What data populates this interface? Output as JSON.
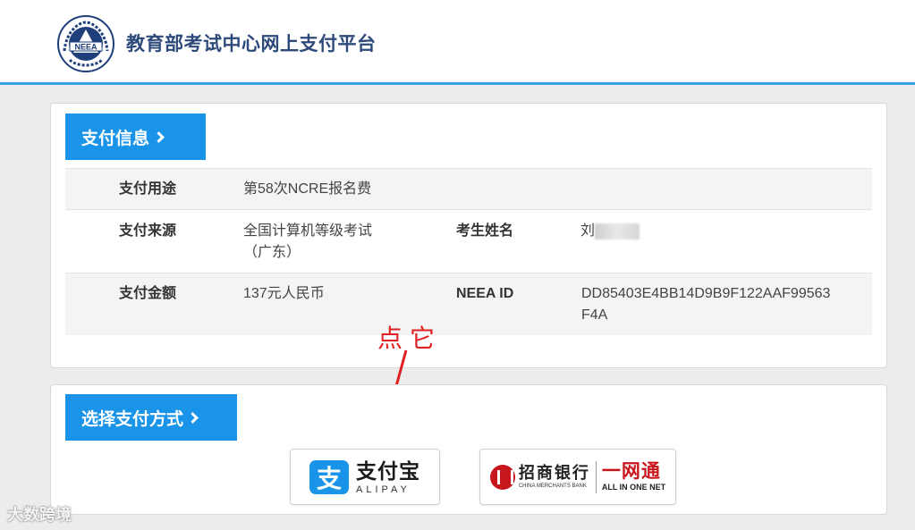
{
  "header": {
    "site_title": "教育部考试中心网上支付平台",
    "logo_text": "NEEA"
  },
  "payment_info": {
    "section_label": "支付信息",
    "rows": [
      {
        "label": "支付用途",
        "value": "第58次NCRE报名费"
      },
      {
        "label": "支付来源",
        "value": "全国计算机等级考试",
        "value_line2": "（广东）",
        "label2": "考生姓名",
        "value2_visible": "刘"
      },
      {
        "label": "支付金额",
        "value": "137元人民币",
        "label2": "NEEA ID",
        "value2": "DD85403E4BB14D9B9F122AAF99563",
        "value2_line2": "F4A"
      }
    ]
  },
  "annotation": {
    "text": "点它",
    "color": "#e02020"
  },
  "payment_method": {
    "section_label": "选择支付方式",
    "options": [
      {
        "id": "alipay",
        "icon_glyph": "支",
        "name_cn": "支付宝",
        "name_en": "ALIPAY"
      },
      {
        "id": "cmb",
        "name_cn": "招商银行",
        "name_en": "CHINA MERCHANTS BANK",
        "product_cn": "一网通",
        "product_en": "ALL IN ONE NET"
      }
    ]
  },
  "watermark": {
    "text": "大数跨境"
  },
  "colors": {
    "accent": "#1a94e8",
    "header_rule": "#3aa0e3",
    "title": "#2d4a7a",
    "cmb_red": "#c8161d"
  }
}
